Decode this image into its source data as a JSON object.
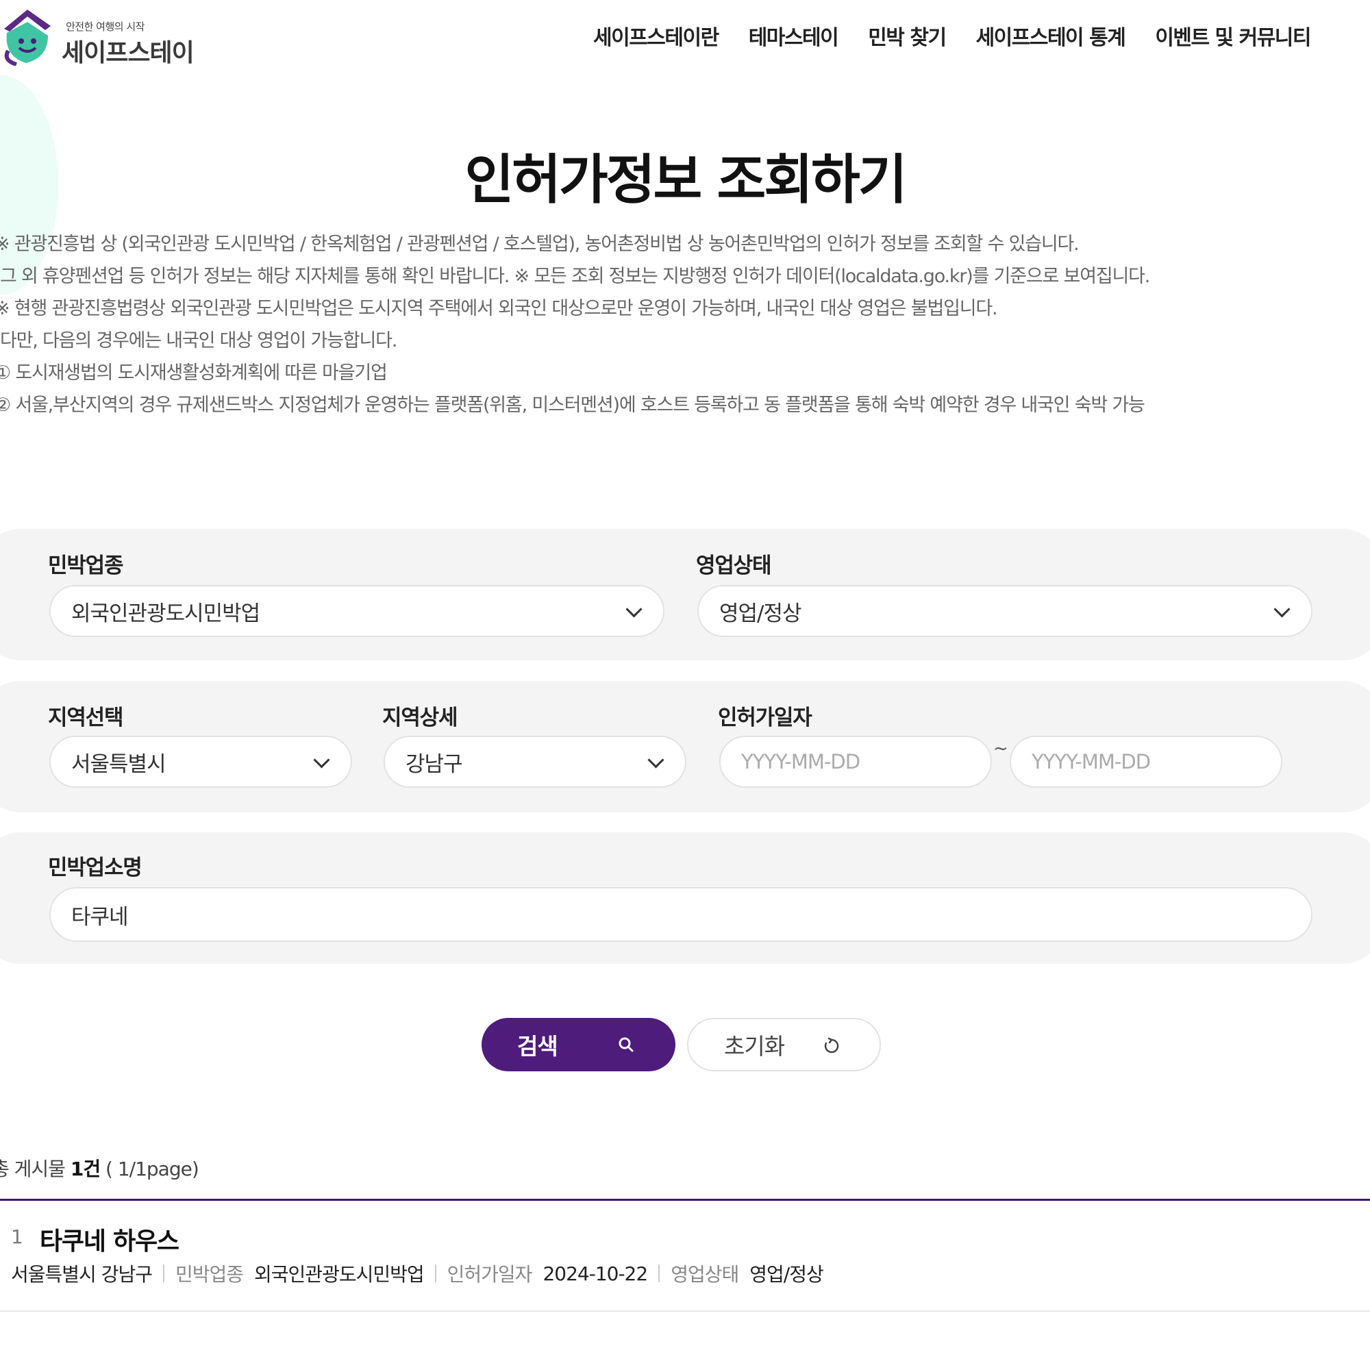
{
  "header": {
    "logo_tagline": "안전한 여행의 시작",
    "logo_name": "세이프스테이",
    "nav": [
      "세이프스테이란",
      "테마스테이",
      "민박 찾기",
      "세이프스테이 통계",
      "이벤트 및 커뮤니티"
    ]
  },
  "page": {
    "title": "인허가정보 조회하기",
    "notes": [
      "※ 관광진흥법 상 (외국인관광 도시민박업 / 한옥체험업 / 관광펜션업 / 호스텔업), 농어촌정비법 상 농어촌민박업의 인허가 정보를 조회할 수 있습니다.",
      "그 외 휴양펜션업 등 인허가 정보는 해당 지자체를 통해 확인 바랍니다. ※ 모든 조회 정보는 지방행정 인허가 데이터(localdata.go.kr)를 기준으로 보여집니다.",
      "※ 현행 관광진흥법령상 외국인관광 도시민박업은 도시지역 주택에서 외국인 대상으로만 운영이 가능하며, 내국인 대상 영업은 불법입니다.",
      "다만, 다음의 경우에는 내국인 대상 영업이 가능합니다.",
      "① 도시재생법의 도시재생활성화계획에 따른 마을기업",
      "② 서울,부산지역의 경우 규제샌드박스 지정업체가 운영하는 플랫폼(위홈, 미스터멘션)에 호스트 등록하고 동 플랫폼을 통해 숙박 예약한 경우 내국인 숙박 가능"
    ]
  },
  "filters": {
    "business_type": {
      "label": "민박업종",
      "value": "외국인관광도시민박업"
    },
    "status": {
      "label": "영업상태",
      "value": "영업/정상"
    },
    "region": {
      "label": "지역선택",
      "value": "서울특별시"
    },
    "region_detail": {
      "label": "지역상세",
      "value": "강남구"
    },
    "permit_date": {
      "label": "인허가일자",
      "from_placeholder": "YYYY-MM-DD",
      "to_placeholder": "YYYY-MM-DD",
      "separator": "~"
    },
    "name": {
      "label": "민박업소명",
      "value": "타쿠네"
    }
  },
  "buttons": {
    "search": "검색",
    "reset": "초기화"
  },
  "results": {
    "count_prefix": "총 게시물 ",
    "count": "1건",
    "page_info": " ( 1/1page)",
    "items": [
      {
        "number": "1",
        "title": "타쿠네 하우스",
        "region": "서울특별시 강남구",
        "type_label": "민박업종",
        "type": "외국인관광도시민박업",
        "date_label": "인허가일자",
        "date": "2024-10-22",
        "status_label": "영업상태",
        "status": "영업/정상"
      }
    ]
  },
  "colors": {
    "brand_purple": "#4e1c7a",
    "logo_teal": "#3fc4a4",
    "panel_gray": "#f4f4f4"
  }
}
